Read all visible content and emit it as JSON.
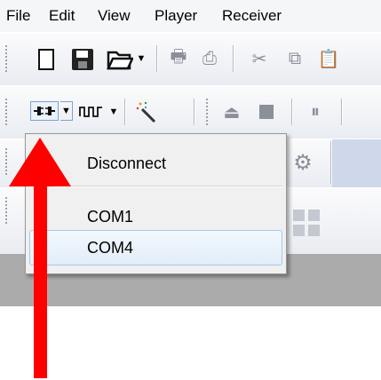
{
  "menubar": {
    "items": [
      "File",
      "Edit",
      "View",
      "Player",
      "Receiver"
    ]
  },
  "toolbar": {
    "new_icon": "new-document-icon",
    "save_icon": "save-icon",
    "open_icon": "open-folder-icon",
    "connect_icon": "serial-connect-icon",
    "signal_icon": "square-wave-icon",
    "wizard_icon": "magic-wand-icon"
  },
  "dropdown": {
    "items": [
      "Disconnect",
      "COM1",
      "COM4"
    ],
    "highlighted": "COM4"
  },
  "annotation": {
    "arrow_color": "#ff0000"
  }
}
